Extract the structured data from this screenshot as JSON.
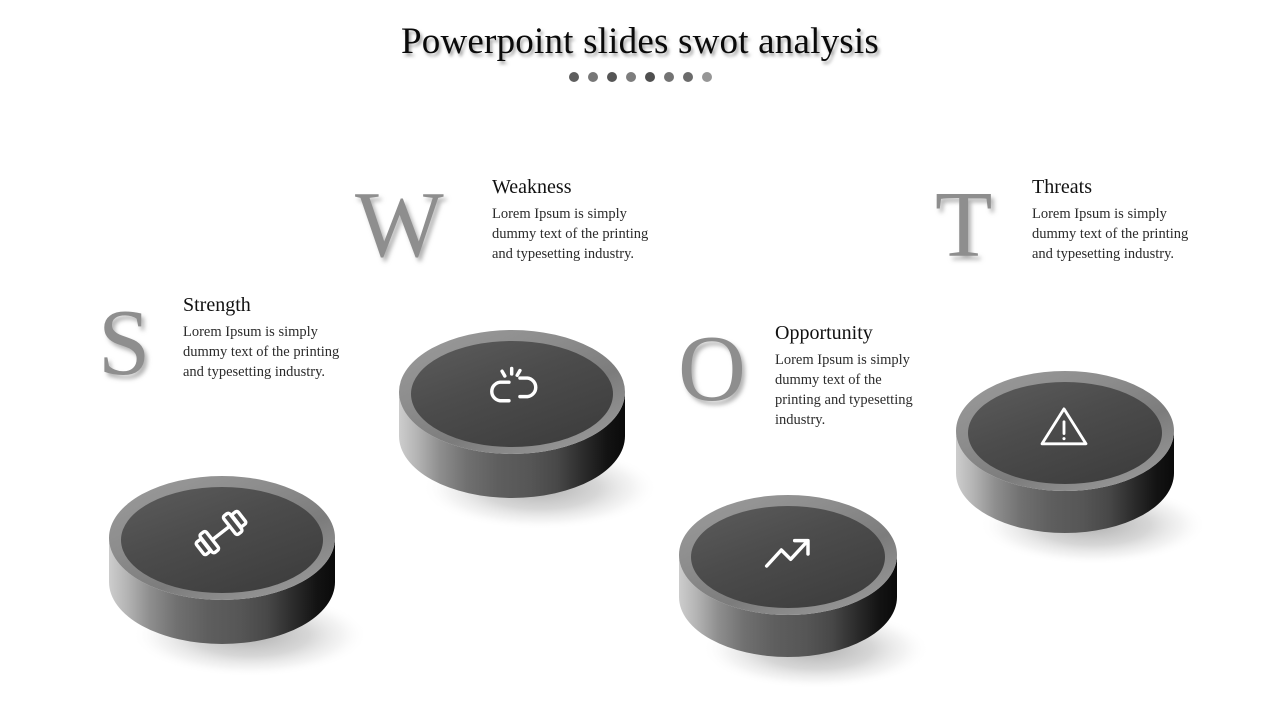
{
  "slide": {
    "background_color": "#ffffff",
    "title": "Powerpoint slides swot analysis",
    "title_color": "#0a0a0a",
    "accent_color": "#8e8e8e",
    "dots": [
      {
        "color": "#5e5e5e"
      },
      {
        "color": "#777777"
      },
      {
        "color": "#555555"
      },
      {
        "color": "#7d7d7d"
      },
      {
        "color": "#4f4f4f"
      },
      {
        "color": "#737373"
      },
      {
        "color": "#6b6b6b"
      },
      {
        "color": "#969696"
      }
    ]
  },
  "groups": [
    {
      "key": "strength",
      "letter": "S",
      "heading": "Strength",
      "body": "Lorem Ipsum is simply dummy text of the printing and typesetting industry.",
      "icon": "dumbbell-icon",
      "cylinder_color_top": "#4a4a4a",
      "cylinder_color_rim": "#8a8a8a"
    },
    {
      "key": "weakness",
      "letter": "W",
      "heading": "Weakness",
      "body": "Lorem Ipsum is simply dummy text of the printing and typesetting industry.",
      "icon": "broken-link-icon",
      "cylinder_color_top": "#4a4a4a",
      "cylinder_color_rim": "#8a8a8a"
    },
    {
      "key": "opportunity",
      "letter": "O",
      "heading": "Opportunity",
      "body": "Lorem Ipsum is simply dummy text of the printing and typesetting industry.",
      "icon": "trending-up-icon",
      "cylinder_color_top": "#4a4a4a",
      "cylinder_color_rim": "#8a8a8a"
    },
    {
      "key": "threats",
      "letter": "T",
      "heading": "Threats",
      "body": "Lorem Ipsum is simply dummy text of the printing and typesetting industry.",
      "icon": "warning-triangle-icon",
      "cylinder_color_top": "#4a4a4a",
      "cylinder_color_rim": "#8a8a8a"
    }
  ]
}
